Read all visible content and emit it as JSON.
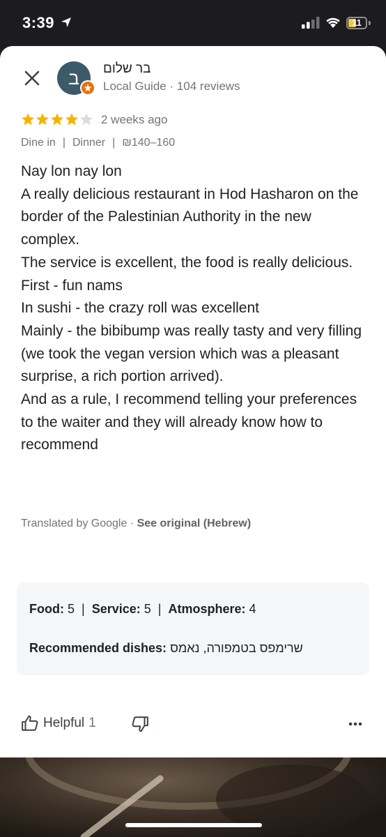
{
  "status_bar": {
    "time": "3:39",
    "battery": "11"
  },
  "reviewer": {
    "avatar_letter": "ב",
    "name": "בר שלום",
    "meta": "Local Guide · 104 reviews"
  },
  "review": {
    "rating": 4,
    "max_rating": 5,
    "date": "2 weeks ago",
    "tags": [
      "Dine in",
      "Dinner",
      "₪140–160"
    ],
    "text_lines": [
      "Nay lon nay lon",
      "A really delicious restaurant in Hod Hasharon on the border of the Palestinian Authority in the new complex.",
      "The service is excellent, the food is really delicious.",
      "First - fun nams",
      "In sushi - the crazy roll was excellent",
      "Mainly - the bibibump was really tasty and very filling (we took the vegan version which was a pleasant surprise, a rich portion arrived).",
      "And as a rule, I recommend telling your preferences to the waiter and they will already know how to recommend"
    ],
    "translated_by": "Translated by Google · ",
    "see_original": "See original (Hebrew)"
  },
  "ratings": {
    "food_label": "Food:",
    "food_value": "5",
    "service_label": "Service:",
    "service_value": "5",
    "atmosphere_label": "Atmosphere:",
    "atmosphere_value": "4",
    "dishes_label": "Recommended dishes:",
    "dishes_value": "שרימפס בטמפורה, נאמס"
  },
  "actions": {
    "helpful_label": "Helpful",
    "helpful_count": "1"
  },
  "colors": {
    "star_filled": "#f4b400",
    "star_empty": "#dadce0",
    "avatar_bg": "#3c5a6a",
    "guide_badge": "#e8710a"
  },
  "icons": [
    "location-arrow-icon",
    "signal-icon",
    "wifi-icon",
    "battery-icon",
    "close-icon",
    "local-guide-star-icon",
    "star-icon",
    "thumbs-up-icon",
    "thumbs-down-icon",
    "more-horizontal-icon"
  ]
}
